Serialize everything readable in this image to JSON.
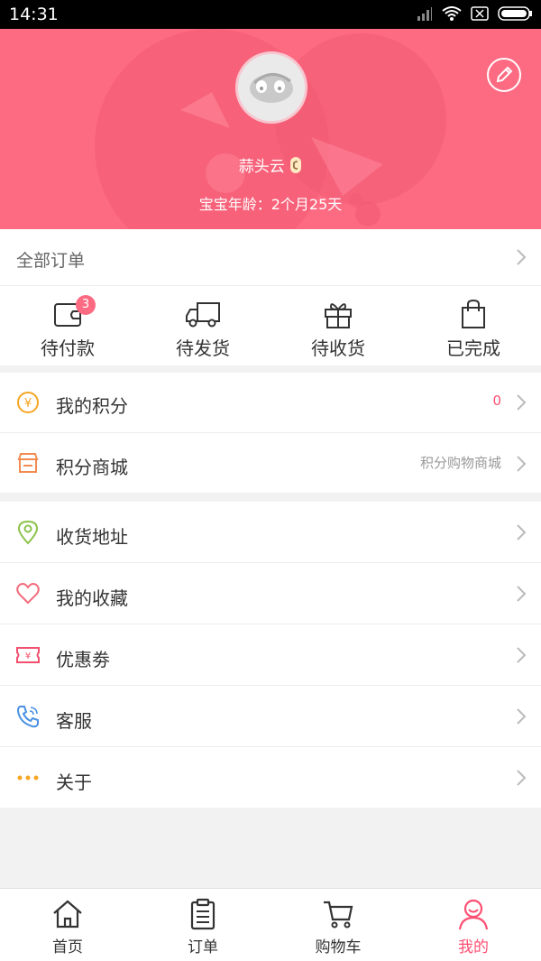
{
  "status_bar": {
    "time": "14:31"
  },
  "profile": {
    "username": "蒜头云",
    "baby_age": "宝宝年龄：2个月25天"
  },
  "orders": {
    "header_label": "全部订单",
    "tabs": [
      {
        "label": "待付款",
        "icon": "wallet-icon",
        "badge": "3"
      },
      {
        "label": "待发货",
        "icon": "truck-icon"
      },
      {
        "label": "待收货",
        "icon": "gift-icon"
      },
      {
        "label": "已完成",
        "icon": "bag-icon"
      }
    ]
  },
  "menu": {
    "points": {
      "label": "我的积分",
      "value": "0",
      "icon": "coin-icon"
    },
    "points_mall": {
      "label": "积分商城",
      "extra": "积分购物商城",
      "icon": "store-icon"
    },
    "address": {
      "label": "收货地址",
      "icon": "location-icon"
    },
    "favorites": {
      "label": "我的收藏",
      "icon": "heart-icon"
    },
    "coupons": {
      "label": "优惠劵",
      "icon": "ticket-icon"
    },
    "service": {
      "label": "客服",
      "icon": "phone-icon"
    },
    "about": {
      "label": "关于",
      "icon": "more-dots-icon"
    }
  },
  "tab_bar": {
    "items": [
      {
        "label": "首页",
        "icon": "home-icon"
      },
      {
        "label": "订单",
        "icon": "clipboard-icon"
      },
      {
        "label": "购物车",
        "icon": "cart-icon"
      },
      {
        "label": "我的",
        "icon": "user-icon",
        "active": true
      }
    ]
  },
  "colors": {
    "brand": "#fd6b82",
    "active": "#fd4f72",
    "points_value": "#fd4f72"
  }
}
